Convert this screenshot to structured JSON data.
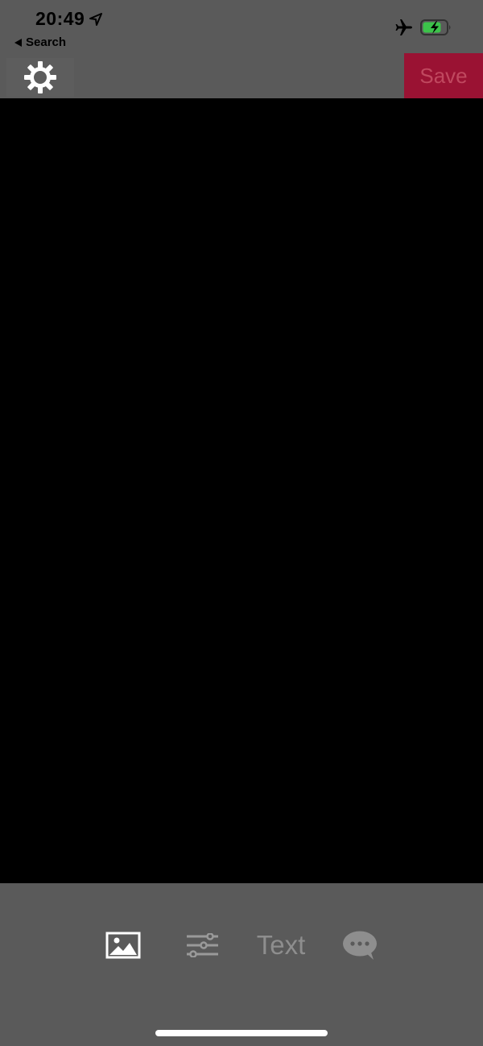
{
  "status_bar": {
    "time": "20:49",
    "back_label": "Search"
  },
  "toolbar": {
    "settings_icon": "gear-icon",
    "save_label": "Save",
    "save_color": "#9a1233"
  },
  "canvas": {
    "background": "#000000"
  },
  "tools": {
    "image_icon": "image-icon",
    "adjust_icon": "sliders-icon",
    "text_label": "Text",
    "bubble_icon": "speech-bubble-icon"
  }
}
